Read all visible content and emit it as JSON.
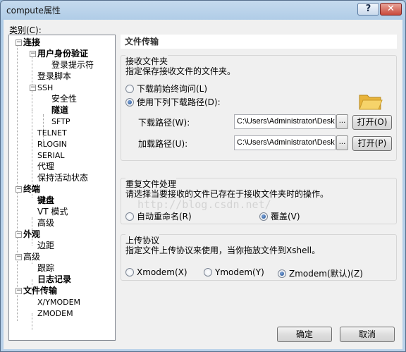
{
  "window": {
    "title": "compute属性",
    "help_glyph": "?",
    "close_glyph": "✕"
  },
  "category_label": "类别(C):",
  "tree": {
    "expand_glyph": "−",
    "items": [
      {
        "label": "连接"
      },
      {
        "label": "用户身份验证"
      },
      {
        "label": "登录提示符"
      },
      {
        "label": "登录脚本"
      },
      {
        "label": "SSH"
      },
      {
        "label": "安全性"
      },
      {
        "label": "隧道"
      },
      {
        "label": "SFTP"
      },
      {
        "label": "TELNET"
      },
      {
        "label": "RLOGIN"
      },
      {
        "label": "SERIAL"
      },
      {
        "label": "代理"
      },
      {
        "label": "保持活动状态"
      },
      {
        "label": "终端"
      },
      {
        "label": "键盘"
      },
      {
        "label": "VT 模式"
      },
      {
        "label": "高级"
      },
      {
        "label": "外观"
      },
      {
        "label": "边距"
      },
      {
        "label": "高级"
      },
      {
        "label": "跟踪"
      },
      {
        "label": "日志记录"
      },
      {
        "label": "文件传输"
      },
      {
        "label": "X/YMODEM"
      },
      {
        "label": "ZMODEM"
      }
    ]
  },
  "panel": {
    "section_title": "文件传输",
    "receive": {
      "title": "接收文件夹",
      "desc": "指定保存接收文件的文件夹。",
      "opt_ask": "下载前始终询问(L)",
      "opt_path": "使用下列下载路径(D):",
      "selected": "path",
      "download_label": "下载路径(W):",
      "download_value": "C:\\Users\\Administrator\\Desk",
      "upload_label": "加载路径(U):",
      "upload_value": "C:\\Users\\Administrator\\Desk",
      "dots": "...",
      "open_label_1": "打开(O)",
      "open_label_2": "打开(P)"
    },
    "duplicate": {
      "title": "重复文件处理",
      "desc": "请选择当要接收的文件已存在于接收文件夹时的操作。",
      "opt_rename": "自动重命名(R)",
      "opt_overwrite": "覆盖(V)",
      "selected": "overwrite"
    },
    "upload": {
      "title": "上传协议",
      "desc": "指定文件上传协议来使用，当你拖放文件到Xshell。",
      "opt_x": "Xmodem(X)",
      "opt_y": "Ymodem(Y)",
      "opt_z": "Zmodem(默认)(Z)",
      "selected": "zmodem"
    }
  },
  "watermark": "http://blog.csdn.net/",
  "buttons": {
    "ok": "确定",
    "cancel": "取消"
  },
  "colors": {
    "title_bg": "#c5daee",
    "close_red": "#c9493a",
    "folder_yellow": "#f3c64c"
  }
}
